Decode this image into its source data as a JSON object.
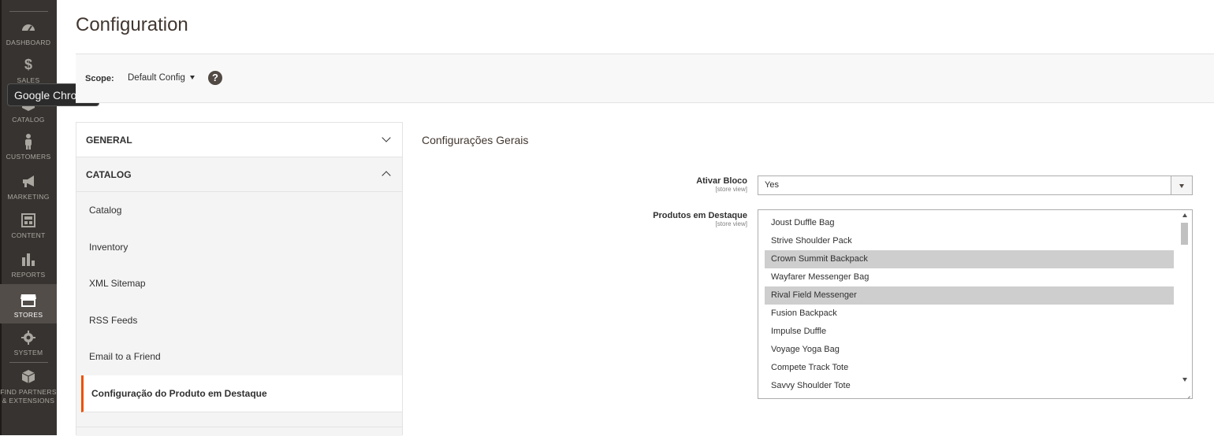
{
  "menu": {
    "items": [
      {
        "label": "DASHBOARD",
        "icon": "dashboard-icon"
      },
      {
        "label": "SALES",
        "icon": "dollar-icon"
      },
      {
        "label": "CATALOG",
        "icon": "cube-icon"
      },
      {
        "label": "CUSTOMERS",
        "icon": "person-icon"
      },
      {
        "label": "MARKETING",
        "icon": "megaphone-icon"
      },
      {
        "label": "CONTENT",
        "icon": "layout-icon"
      },
      {
        "label": "REPORTS",
        "icon": "bar-chart-icon"
      },
      {
        "label": "STORES",
        "icon": "store-icon"
      },
      {
        "label": "SYSTEM",
        "icon": "gear-icon"
      },
      {
        "label_line1": "FIND PARTNERS",
        "label_line2": "& EXTENSIONS",
        "icon": "box-icon"
      }
    ],
    "active": "STORES"
  },
  "tooltip": "Google Chrome",
  "page": {
    "title": "Configuration"
  },
  "scope": {
    "label": "Scope:",
    "value": "Default Config",
    "help": "?"
  },
  "tabs": {
    "general": "GENERAL",
    "catalog": "CATALOG",
    "items": [
      "Catalog",
      "Inventory",
      "XML Sitemap",
      "RSS Feeds",
      "Email to a Friend",
      "Configuração do Produto em Destaque"
    ]
  },
  "section": {
    "title": "Configurações Gerais",
    "ativar_bloco": {
      "label": "Ativar Bloco",
      "scope": "[store view]",
      "value": "Yes"
    },
    "produtos": {
      "label": "Produtos em Destaque",
      "scope": "[store view]",
      "options": [
        {
          "label": "Joust Duffle Bag",
          "selected": false
        },
        {
          "label": "Strive Shoulder Pack",
          "selected": false
        },
        {
          "label": "Crown Summit Backpack",
          "selected": true
        },
        {
          "label": "Wayfarer Messenger Bag",
          "selected": false
        },
        {
          "label": "Rival Field Messenger",
          "selected": true
        },
        {
          "label": "Fusion Backpack",
          "selected": false
        },
        {
          "label": "Impulse Duffle",
          "selected": false
        },
        {
          "label": "Voyage Yoga Bag",
          "selected": false
        },
        {
          "label": "Compete Track Tote",
          "selected": false
        },
        {
          "label": "Savvy Shoulder Tote",
          "selected": false
        }
      ]
    }
  },
  "colors": {
    "menu_bg": "#373330",
    "active_tab_border": "#eb5202",
    "selected_option": "#cecece"
  }
}
